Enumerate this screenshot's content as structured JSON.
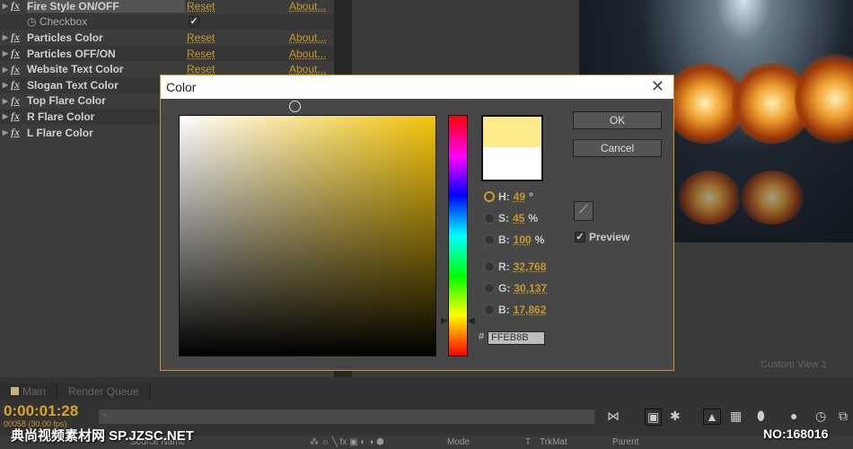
{
  "effects": [
    {
      "name": "Fire Style ON/OFF",
      "reset": "Reset",
      "about": "About..."
    },
    {
      "name": "Checkbox",
      "checked": true,
      "sub": true
    },
    {
      "name": "Particles Color",
      "reset": "Reset",
      "about": "About..."
    },
    {
      "name": "Particles OFF/ON",
      "reset": "Reset",
      "about": "About..."
    },
    {
      "name": "Website Text Color",
      "reset": "Reset",
      "about": "About..."
    },
    {
      "name": "Slogan Text Color"
    },
    {
      "name": "Top Flare Color"
    },
    {
      "name": "R Flare Color"
    },
    {
      "name": "L Flare Color"
    }
  ],
  "dialog": {
    "title": "Color",
    "ok": "OK",
    "cancel": "Cancel",
    "preview": "Preview",
    "preview_checked": true,
    "new_color": "#FFEB8B",
    "old_color": "#FFFFFF",
    "h": {
      "label": "H:",
      "value": "49",
      "unit": "°"
    },
    "s": {
      "label": "S:",
      "value": "45",
      "unit": "%"
    },
    "b": {
      "label": "B:",
      "value": "100",
      "unit": "%"
    },
    "r": {
      "label": "R:",
      "value": "32,768"
    },
    "g": {
      "label": "G:",
      "value": "30,137"
    },
    "b2": {
      "label": "B:",
      "value": "17,862"
    },
    "hex_label": "#",
    "hex": "FFEB8B"
  },
  "viewer": {
    "view": "Custom View 1"
  },
  "timeline": {
    "tabs": [
      "Main",
      "Render Queue"
    ],
    "timecode": "0:00:01:28",
    "frames": "00058 (30.00 fps)",
    "columns": {
      "source": "Source Name",
      "mode": "Mode",
      "t": "T",
      "trkmat": "TrkMat",
      "parent": "Parent"
    }
  },
  "watermark": {
    "left": "典尚视频素材网 SP.JZSC.NET",
    "right": "NO:168016"
  },
  "colors": {
    "accent": "#C99A2A",
    "dialog_border": "#C8962A"
  }
}
